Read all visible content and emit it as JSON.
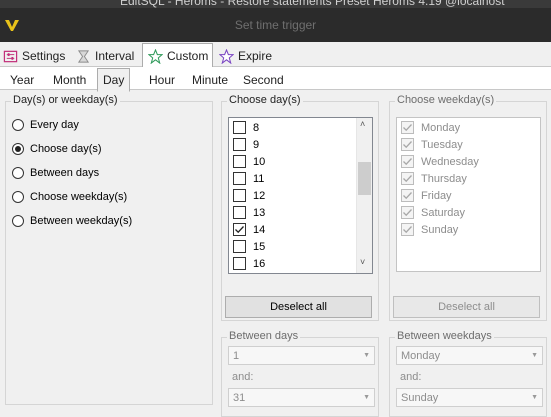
{
  "window": {
    "title": "EditSQL - Heroms - Restore statements Preset Heroms 4.19 @localhost"
  },
  "dialog": {
    "title": "Set time trigger",
    "app_icon": "v-logo-icon"
  },
  "top_tabs": [
    {
      "label": "Settings",
      "icon": "settings-icon",
      "active": false
    },
    {
      "label": "Interval",
      "icon": "interval-icon",
      "active": false
    },
    {
      "label": "Custom",
      "icon": "custom-icon",
      "active": true
    },
    {
      "label": "Expire",
      "icon": "expire-icon",
      "active": false
    }
  ],
  "sub_tabs": [
    {
      "label": "Year",
      "active": false
    },
    {
      "label": "Month",
      "active": false
    },
    {
      "label": "Day",
      "active": true
    },
    {
      "label": "Hour",
      "active": false
    },
    {
      "label": "Minute",
      "active": false
    },
    {
      "label": "Second",
      "active": false
    }
  ],
  "day_or_weekday": {
    "legend": "Day(s) or weekday(s)",
    "options": [
      {
        "label": "Every day",
        "selected": false
      },
      {
        "label": "Choose day(s)",
        "selected": true
      },
      {
        "label": "Between days",
        "selected": false
      },
      {
        "label": "Choose weekday(s)",
        "selected": false
      },
      {
        "label": "Between weekday(s)",
        "selected": false
      }
    ]
  },
  "choose_days": {
    "legend": "Choose day(s)",
    "items": [
      {
        "label": "8",
        "checked": false
      },
      {
        "label": "9",
        "checked": false
      },
      {
        "label": "10",
        "checked": false
      },
      {
        "label": "11",
        "checked": false
      },
      {
        "label": "12",
        "checked": false
      },
      {
        "label": "13",
        "checked": false
      },
      {
        "label": "14",
        "checked": true
      },
      {
        "label": "15",
        "checked": false
      },
      {
        "label": "16",
        "checked": false
      }
    ],
    "deselect_label": "Deselect all"
  },
  "choose_weekdays": {
    "legend": "Choose weekday(s)",
    "items": [
      {
        "label": "Monday",
        "checked": true
      },
      {
        "label": "Tuesday",
        "checked": true
      },
      {
        "label": "Wednesday",
        "checked": true
      },
      {
        "label": "Thursday",
        "checked": true
      },
      {
        "label": "Friday",
        "checked": true
      },
      {
        "label": "Saturday",
        "checked": true
      },
      {
        "label": "Sunday",
        "checked": true
      }
    ],
    "deselect_label": "Deselect all"
  },
  "between_days": {
    "legend": "Between days",
    "from_value": "1",
    "and_label": "and:",
    "to_value": "31"
  },
  "between_weekdays": {
    "legend": "Between weekdays",
    "from_value": "Monday",
    "and_label": "and:",
    "to_value": "Sunday"
  }
}
